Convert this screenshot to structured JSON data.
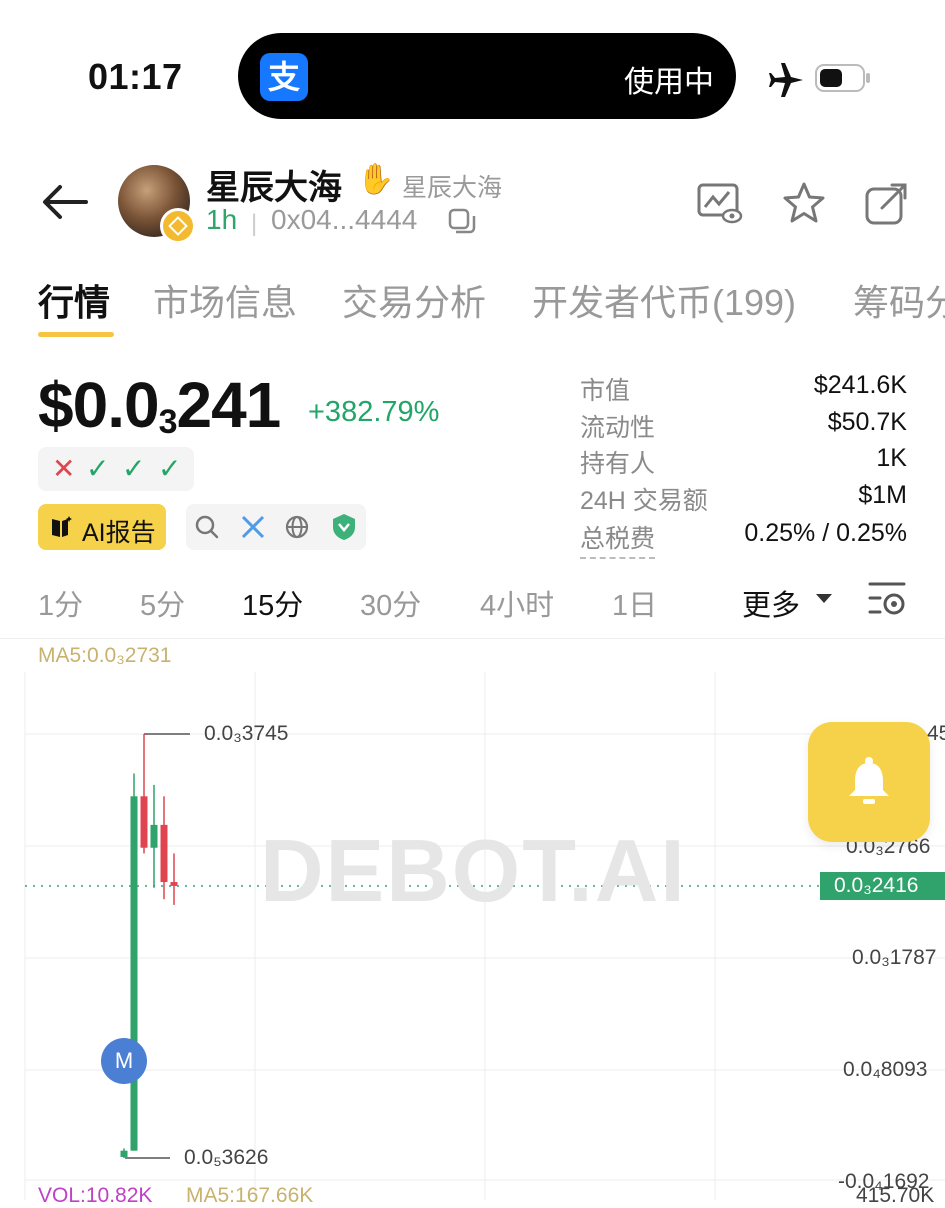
{
  "status_bar": {
    "time": "01:17",
    "island_app_glyph": "支",
    "island_status": "使用中",
    "icons": [
      "airplane-icon",
      "battery-icon"
    ]
  },
  "header": {
    "token_name": "星辰大海",
    "token_alias": "星辰大海",
    "age": "1h",
    "address": "0x04...4444",
    "icons": [
      "back-arrow-icon",
      "watch-chart-icon",
      "star-icon",
      "share-icon",
      "copy-icon",
      "hand-icon"
    ]
  },
  "tabs": [
    {
      "label": "行情",
      "active": true
    },
    {
      "label": "市场信息",
      "active": false
    },
    {
      "label": "交易分析",
      "active": false
    },
    {
      "label": "开发者代币(199)",
      "active": false
    },
    {
      "label": "筹码分",
      "active": false
    }
  ],
  "price": {
    "prefix": "$0.0",
    "subscript": "3",
    "digits": "241",
    "change": "+382.79%",
    "checks": [
      "✕",
      "✓",
      "✓",
      "✓"
    ],
    "ai_report_label": "AI报告",
    "link_icons": [
      "search-icon",
      "x-icon",
      "globe-icon",
      "shield-icon"
    ]
  },
  "stats": [
    {
      "label": "市值",
      "value": "$241.6K"
    },
    {
      "label": "流动性",
      "value": "$50.7K"
    },
    {
      "label": "持有人",
      "value": "1K"
    },
    {
      "label": "24H 交易额",
      "value": "$1M"
    },
    {
      "label": "总税费",
      "value": "0.25% / 0.25%"
    }
  ],
  "timeframes": [
    {
      "label": "1分",
      "active": false
    },
    {
      "label": "5分",
      "active": false
    },
    {
      "label": "15分",
      "active": true
    },
    {
      "label": "30分",
      "active": false
    },
    {
      "label": "4小时",
      "active": false
    },
    {
      "label": "1日",
      "active": false
    }
  ],
  "more_label": "更多",
  "chart": {
    "ma5": "MA5:0.0₃2731",
    "watermark": "DEBOT.AI",
    "high_label": "0.0₃3745",
    "low_label": "0.0₅3626",
    "y_labels": [
      "45",
      "0.0₃2766",
      "0.0₃1787",
      "0.0₄8093",
      "-0.0₄1692"
    ],
    "current_price": "0.0₃2416",
    "marker_label": "M",
    "vol_label": "VOL:10.82K",
    "vol_ma5": "MA5:167.66K",
    "vol_axis": "415.70K",
    "up_color": "#2fa36b",
    "down_color": "#e0454f"
  },
  "chart_data": {
    "type": "candlestick",
    "y_unit": "price ($)",
    "candles": [
      {
        "o": 4.5e-06,
        "h": 1.2e-05,
        "l": 3.6e-06,
        "c": 1e-05
      },
      {
        "o": 1e-05,
        "h": 0.00034,
        "l": 1e-05,
        "c": 0.00032
      },
      {
        "o": 0.00032,
        "h": 0.0003745,
        "l": 0.00027,
        "c": 0.000275
      },
      {
        "o": 0.000275,
        "h": 0.00033,
        "l": 0.00024,
        "c": 0.000295
      },
      {
        "o": 0.000295,
        "h": 0.00032,
        "l": 0.00023,
        "c": 0.000245
      },
      {
        "o": 0.000245,
        "h": 0.00027,
        "l": 0.000225,
        "c": 0.0002416
      }
    ],
    "current_price": 0.0002416,
    "ma5": 0.0002731
  }
}
